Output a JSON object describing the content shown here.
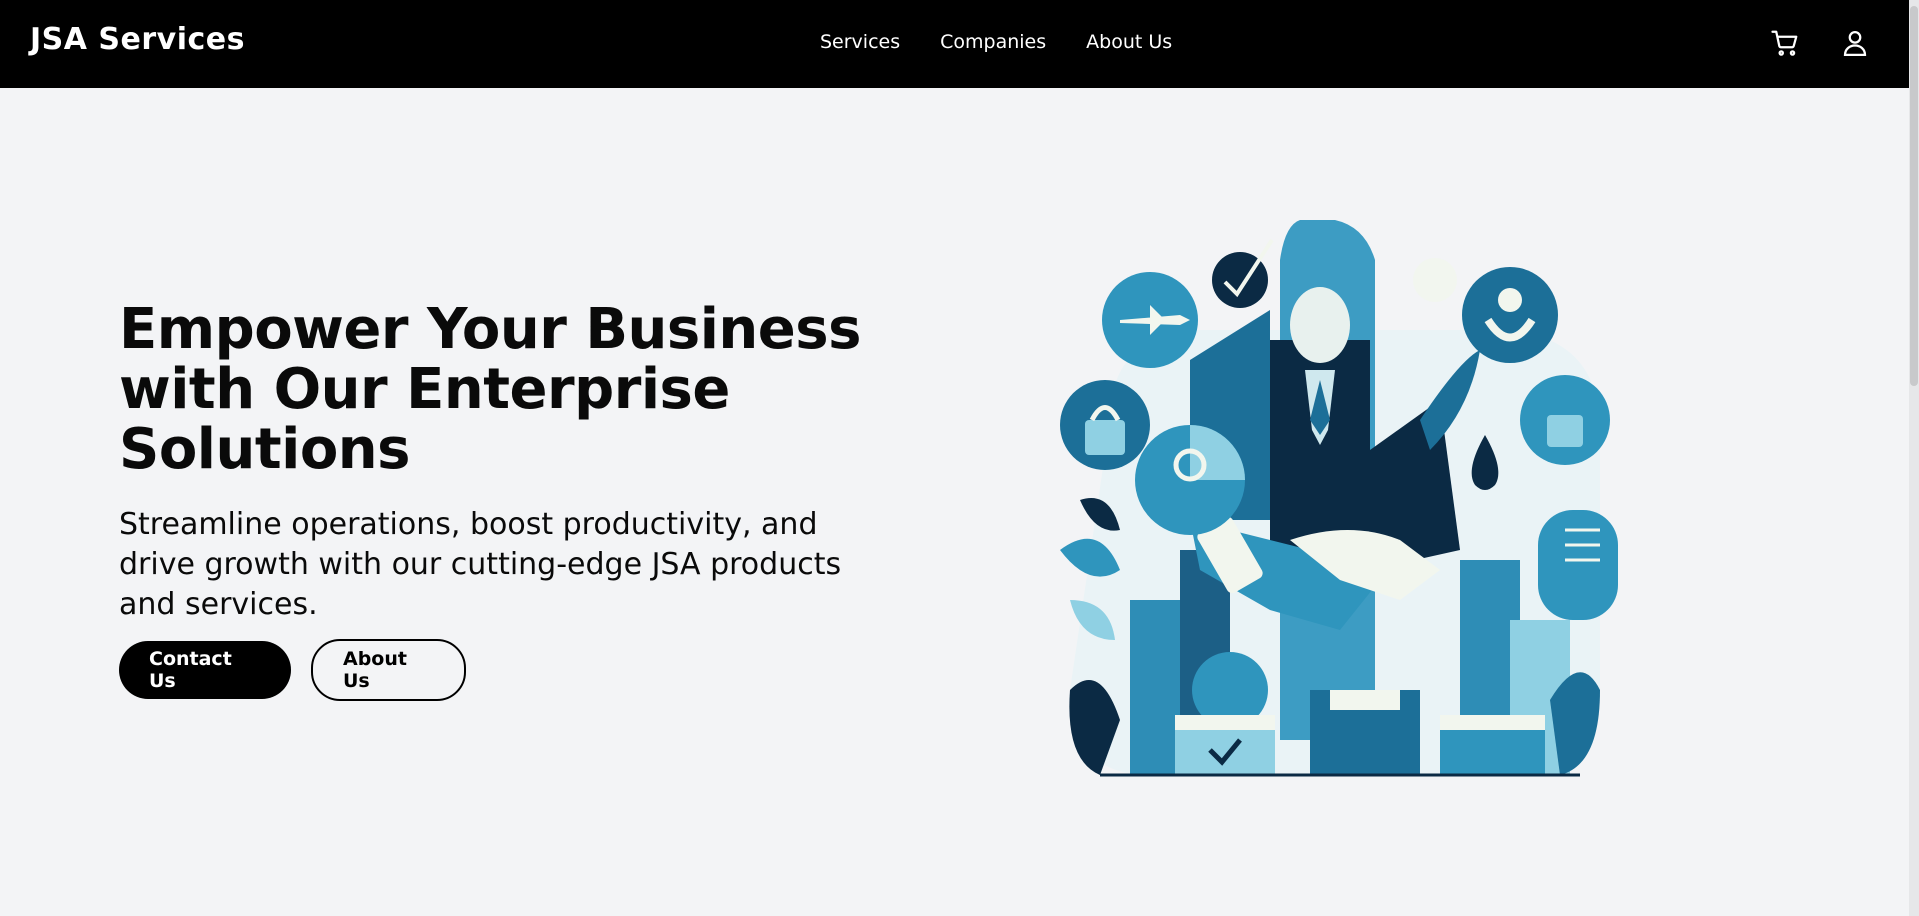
{
  "header": {
    "brand": "JSA Services",
    "nav": [
      "Services",
      "Companies",
      "About Us"
    ],
    "icons": [
      "cart-icon",
      "user-icon"
    ]
  },
  "hero": {
    "title": "Empower Your Business with Our Enterprise Solutions",
    "subtitle": "Streamline operations, boost productivity, and drive growth with our cutting-edge JSA products and services.",
    "primary_button": "Contact Us",
    "secondary_button": "About Us"
  },
  "colors": {
    "header_bg": "#000000",
    "page_bg": "#f3f4f6",
    "accent": "#2f95bd",
    "dark_accent": "#0b2a44"
  }
}
